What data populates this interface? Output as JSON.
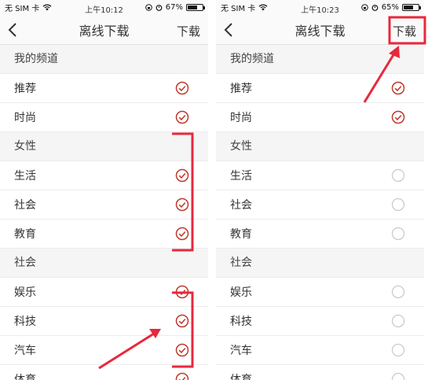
{
  "accent_color": "#c0392b",
  "annotation_color": "#e8283c",
  "screens": [
    {
      "status": {
        "carrier": "无 SIM 卡",
        "time": "上午10:12",
        "battery": "67%",
        "battery_level": 0.67
      },
      "nav": {
        "title": "离线下载",
        "action": "下载"
      },
      "list": [
        {
          "type": "header",
          "label": "我的频道"
        },
        {
          "type": "row",
          "label": "推荐",
          "state": "checked"
        },
        {
          "type": "row",
          "label": "时尚",
          "state": "checked"
        },
        {
          "type": "header",
          "label": "女性"
        },
        {
          "type": "row",
          "label": "生活",
          "state": "checked"
        },
        {
          "type": "row",
          "label": "社会",
          "state": "checked"
        },
        {
          "type": "row",
          "label": "教育",
          "state": "checked"
        },
        {
          "type": "header",
          "label": "社会"
        },
        {
          "type": "row",
          "label": "娱乐",
          "state": "checked"
        },
        {
          "type": "row",
          "label": "科技",
          "state": "checked"
        },
        {
          "type": "row",
          "label": "汽车",
          "state": "checked"
        },
        {
          "type": "row",
          "label": "体育",
          "state": "checked"
        }
      ]
    },
    {
      "status": {
        "carrier": "无 SIM 卡",
        "time": "上午10:23",
        "battery": "65%",
        "battery_level": 0.65
      },
      "nav": {
        "title": "离线下载",
        "action": "下载"
      },
      "list": [
        {
          "type": "header",
          "label": "我的频道"
        },
        {
          "type": "row",
          "label": "推荐",
          "state": "checked"
        },
        {
          "type": "row",
          "label": "时尚",
          "state": "checked"
        },
        {
          "type": "header",
          "label": "女性"
        },
        {
          "type": "row",
          "label": "生活",
          "state": "unchecked"
        },
        {
          "type": "row",
          "label": "社会",
          "state": "unchecked"
        },
        {
          "type": "row",
          "label": "教育",
          "state": "unchecked"
        },
        {
          "type": "header",
          "label": "社会"
        },
        {
          "type": "row",
          "label": "娱乐",
          "state": "unchecked"
        },
        {
          "type": "row",
          "label": "科技",
          "state": "unchecked"
        },
        {
          "type": "row",
          "label": "汽车",
          "state": "unchecked"
        },
        {
          "type": "row",
          "label": "体育",
          "state": "unchecked"
        }
      ]
    }
  ]
}
